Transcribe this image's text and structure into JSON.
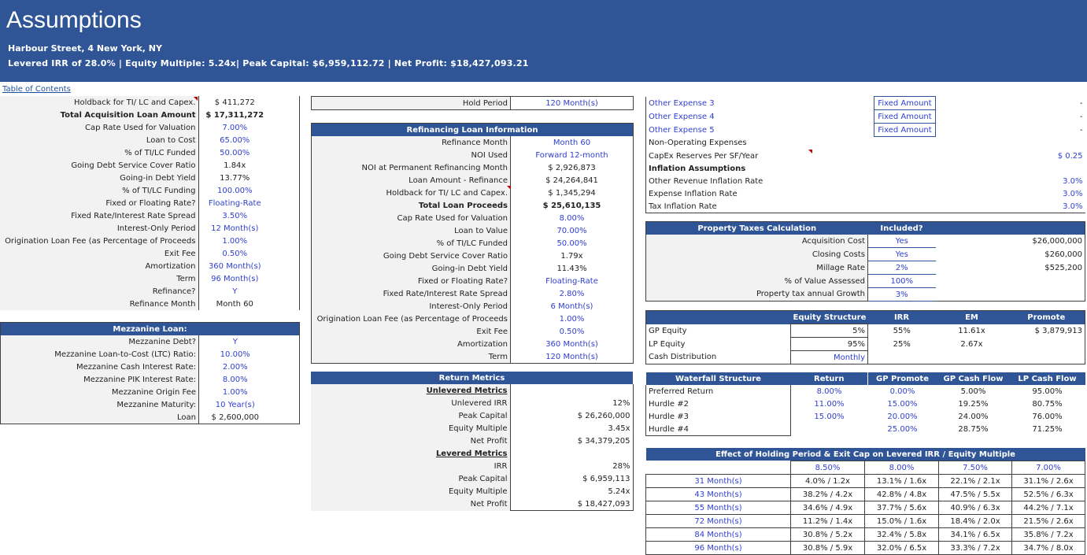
{
  "header": {
    "title": "Assumptions",
    "address": "Harbour Street, 4 New York, NY",
    "summary": "Levered IRR of 28.0% | Equity Multiple: 5.24x| Peak Capital: $6,959,112.72 | Net Profit: $18,427,093.21"
  },
  "toc_link": "Table of Contents",
  "acq_loan": {
    "rows": [
      {
        "label": "Holdback for TI/ LC and Capex.",
        "value": "$ 411,272"
      },
      {
        "label": "Total Acquisition Loan Amount",
        "value": "$ 17,311,272"
      },
      {
        "label": "Cap Rate Used for Valuation",
        "value": "7.00%"
      },
      {
        "label": "Loan to Cost",
        "value": "65.00%"
      },
      {
        "label": "% of TI/LC Funded",
        "value": "50.00%"
      },
      {
        "label": "Going Debt Service Cover Ratio",
        "value": "1.84x"
      },
      {
        "label": "Going-in Debt Yield",
        "value": "13.77%"
      },
      {
        "label": "% of TI/LC Funding",
        "value": "100.00%"
      },
      {
        "label": "Fixed or Floating Rate?",
        "value": "Floating-Rate"
      },
      {
        "label": "Fixed Rate/Interest Rate Spread",
        "value": "3.50%"
      },
      {
        "label": "Interest-Only Period",
        "value": "12 Month(s)"
      },
      {
        "label": "Origination Loan Fee (as Percentage of Proceeds",
        "value": "1.00%"
      },
      {
        "label": "Exit Fee",
        "value": "0.50%"
      },
      {
        "label": "Amortization",
        "value": "360 Month(s)"
      },
      {
        "label": "Term",
        "value": "96 Month(s)"
      },
      {
        "label": "Refinance?",
        "value": "Y"
      },
      {
        "label": "Refinance Month",
        "value": "Month 60"
      }
    ]
  },
  "mezz": {
    "title": "Mezzanine Loan:",
    "rows": [
      {
        "label": "Mezzanine Debt?",
        "value": "Y"
      },
      {
        "label": "Mezzanine Loan-to-Cost (LTC) Ratio:",
        "value": "10.00%"
      },
      {
        "label": "Mezzanine Cash Interest Rate:",
        "value": "2.00%"
      },
      {
        "label": "Mezzanine PIK Interest Rate:",
        "value": "8.00%"
      },
      {
        "label": "Mezzanine Origin Fee",
        "value": "1.00%"
      },
      {
        "label": "Mezzanine Maturity:",
        "value": "10 Year(s)"
      },
      {
        "label": "Loan",
        "value": "$ 2,600,000"
      }
    ]
  },
  "hold": {
    "label": "Hold Period",
    "value": "120 Month(s)"
  },
  "refi": {
    "title": "Refinancing Loan Information",
    "rows": [
      {
        "label": "Refinance Month",
        "value": "Month 60"
      },
      {
        "label": "NOI Used",
        "value": "Forward 12-month"
      },
      {
        "label": "NOI at Permanent Refinancing Month",
        "value": "$ 2,926,873"
      },
      {
        "label": "Loan Amount - Refinance",
        "value": "$ 24,264,841"
      },
      {
        "label": "Holdback for TI/ LC and Capex.",
        "value": "$ 1,345,294"
      },
      {
        "label": "Total Loan Proceeds",
        "value": "$ 25,610,135"
      },
      {
        "label": "Cap Rate Used for Valuation",
        "value": "8.00%"
      },
      {
        "label": "Loan to Value",
        "value": "70.00%"
      },
      {
        "label": "% of TI/LC Funded",
        "value": "50.00%"
      },
      {
        "label": "Going Debt Service Cover Ratio",
        "value": "1.79x"
      },
      {
        "label": "Going-in Debt Yield",
        "value": "11.43%"
      },
      {
        "label": "Fixed or Floating Rate?",
        "value": "Floating-Rate"
      },
      {
        "label": "Fixed Rate/Interest Rate Spread",
        "value": "2.80%"
      },
      {
        "label": "Interest-Only Period",
        "value": "6 Month(s)"
      },
      {
        "label": "Origination Loan Fee (as Percentage of Proceeds",
        "value": "1.00%"
      },
      {
        "label": "Exit Fee",
        "value": "0.50%"
      },
      {
        "label": "Amortization",
        "value": "360 Month(s)"
      },
      {
        "label": "Term",
        "value": "120 Month(s)"
      }
    ]
  },
  "returns": {
    "title": "Return Metrics",
    "unlevered_title": "Unlevered Metrics",
    "unlevered": [
      {
        "label": "Unlevered IRR",
        "value": "12%"
      },
      {
        "label": "Peak Capital",
        "value": "$ 26,260,000"
      },
      {
        "label": "Equity Multiple",
        "value": "3.45x"
      },
      {
        "label": "Net Profit",
        "value": "$ 34,379,205"
      }
    ],
    "levered_title": "Levered Metrics",
    "levered": [
      {
        "label": "IRR",
        "value": "28%"
      },
      {
        "label": "Peak Capital",
        "value": "$ 6,959,113"
      },
      {
        "label": "Equity Multiple",
        "value": "5.24x"
      },
      {
        "label": "Net Profit",
        "value": "$ 18,427,093"
      }
    ]
  },
  "expenses": {
    "rows": [
      {
        "label": "Other Expense 3",
        "type": "Fixed Amount",
        "value": "-"
      },
      {
        "label": "Other Expense 4",
        "type": "Fixed Amount",
        "value": "-"
      },
      {
        "label": "Other Expense 5",
        "type": "Fixed Amount",
        "value": "-"
      }
    ],
    "non_op": "Non-Operating Expenses",
    "capex": {
      "label": "CapEx Reserves Per SF/Year",
      "value": "$ 0.25"
    },
    "inflation_title": "Inflation Assumptions",
    "inflation": [
      {
        "label": "Other Revenue Inflation Rate",
        "value": "3.0%"
      },
      {
        "label": "Expense Inflation Rate",
        "value": "3.0%"
      },
      {
        "label": "Tax Inflation Rate",
        "value": "3.0%"
      }
    ]
  },
  "property_tax": {
    "title": "Property Taxes Calculation",
    "included_header": "Included?",
    "rows": [
      {
        "label": "Acquisition Cost",
        "included": "Yes",
        "value": "$26,000,000"
      },
      {
        "label": "Closing Costs",
        "included": "Yes",
        "value": "$260,000"
      },
      {
        "label": "Millage Rate",
        "included": "2%",
        "value": "$525,200"
      },
      {
        "label": "% of Value Assessed",
        "included": "100%",
        "value": ""
      },
      {
        "label": "Property tax annual Growth",
        "included": "3%",
        "value": ""
      }
    ]
  },
  "equity": {
    "headers": [
      "Equity Structure",
      "IRR",
      "EM",
      "Promote"
    ],
    "rows": [
      {
        "label": "GP Equity",
        "share": "5%",
        "irr": "55%",
        "em": "11.61x",
        "promote": "$ 3,879,913"
      },
      {
        "label": "LP Equity",
        "share": "95%",
        "irr": "25%",
        "em": "2.67x",
        "promote": ""
      },
      {
        "label": "Cash Distribution",
        "share": "Monthly",
        "irr": "",
        "em": "",
        "promote": ""
      }
    ]
  },
  "waterfall": {
    "headers": [
      "Waterfall Structure",
      "Return",
      "GP Promote",
      "GP Cash Flow",
      "LP Cash Flow"
    ],
    "rows": [
      {
        "label": "Preferred Return",
        "ret": "8.00%",
        "gp": "0.00%",
        "gpcf": "5.00%",
        "lpcf": "95.00%"
      },
      {
        "label": "Hurdle #2",
        "ret": "11.00%",
        "gp": "15.00%",
        "gpcf": "19.25%",
        "lpcf": "80.75%"
      },
      {
        "label": "Hurdle #3",
        "ret": "15.00%",
        "gp": "20.00%",
        "gpcf": "24.00%",
        "lpcf": "76.00%"
      },
      {
        "label": "Hurdle #4",
        "ret": "",
        "gp": "25.00%",
        "gpcf": "28.75%",
        "lpcf": "71.25%"
      }
    ]
  },
  "sensitivity": {
    "title": "Effect of Holding Period & Exit Cap on Levered IRR / Equity Multiple",
    "caps": [
      "8.50%",
      "8.00%",
      "7.50%",
      "7.00%"
    ],
    "rows": [
      {
        "period": "31 Month(s)",
        "vals": [
          "4.0% / 1.2x",
          "13.1% / 1.6x",
          "22.1% / 2.1x",
          "31.1% / 2.6x"
        ]
      },
      {
        "period": "43 Month(s)",
        "vals": [
          "38.2% / 4.2x",
          "42.8% / 4.8x",
          "47.5% / 5.5x",
          "52.5% / 6.3x"
        ]
      },
      {
        "period": "55 Month(s)",
        "vals": [
          "34.6% / 4.9x",
          "37.7% / 5.6x",
          "40.9% / 6.3x",
          "44.2% / 7.1x"
        ]
      },
      {
        "period": "72 Month(s)",
        "vals": [
          "11.2% / 1.4x",
          "15.0% / 1.6x",
          "18.4% / 2.0x",
          "21.5% / 2.6x"
        ]
      },
      {
        "period": "84 Month(s)",
        "vals": [
          "30.8% / 5.2x",
          "32.4% / 5.8x",
          "34.1% / 6.5x",
          "35.8% / 7.2x"
        ]
      },
      {
        "period": "96 Month(s)",
        "vals": [
          "30.8% / 5.9x",
          "32.0% / 6.5x",
          "33.3% / 7.2x",
          "34.7% / 8.0x"
        ]
      }
    ]
  }
}
